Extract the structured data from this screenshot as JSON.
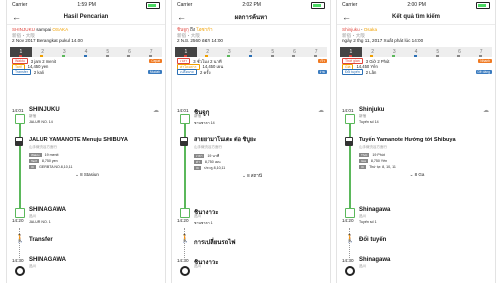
{
  "phones": [
    {
      "status": {
        "carrier": "Carrier",
        "time": "1:59 PM"
      },
      "nav": {
        "back": "←",
        "title": "Hasil Pencarian"
      },
      "route": {
        "from": "SHINJUKU",
        "mid": " sampai ",
        "to": "OSAKA",
        "kana": "新宿・大阪",
        "date": "2 Nov 2017 Berangkat pukul 14.00"
      },
      "tabs": [
        "1",
        "2",
        "3",
        "4",
        "5",
        "6",
        "7"
      ],
      "summary": [
        {
          "tag": "Waktu",
          "text": "3 jam 2 menit",
          "badge": "Cepat",
          "badge_color": "orange"
        },
        {
          "tag": "Tarif",
          "text": "14,450 yen",
          "badge": "",
          "badge_color": ""
        },
        {
          "tag": "Transfer",
          "text": "2 kali",
          "badge": "Mudah",
          "badge_color": "blue"
        }
      ],
      "stop1": {
        "time": "14:01",
        "name": "SHINJUKU",
        "kana": "新宿",
        "platform": "JALUR NO. 14",
        "weather": "☁"
      },
      "train": {
        "name": "JALUR YAMANOTE Menuju SHIBUYA",
        "kana": "山手線渋谷方面行",
        "fares": [
          {
            "label": "Waktu",
            "value": "19 menit"
          },
          {
            "label": "Tarif",
            "value": "8,750 yen"
          },
          {
            "label": "IC",
            "value": "GERBTA NO.8,10,11"
          }
        ],
        "stations": "⌄  8 Stasiun"
      },
      "stop2": {
        "time": "14:20",
        "name": "SHINAGAWA",
        "kana": "品川",
        "platform": "JALUR NO. 1"
      },
      "transfer": {
        "label": "Transfer"
      },
      "stop3": {
        "time": "14:30",
        "name": "SHINAGAWA",
        "kana": "品川"
      }
    },
    {
      "status": {
        "carrier": "Carrier",
        "time": "2:02 PM"
      },
      "nav": {
        "back": "←",
        "title": "ผลการค้นหา"
      },
      "route": {
        "from": "ชินจูกุ",
        "mid": " ถึง ",
        "to": "โอซาก้า",
        "kana": "新宿・大阪",
        "date": "2 พ.ย. 2560 ออก 14:00"
      },
      "tabs": [
        "1",
        "2",
        "3",
        "4",
        "5",
        "6",
        "7"
      ],
      "summary": [
        {
          "tag": "เวลา",
          "text": "3 ชั่วโมง 2 นาที",
          "badge": "เร็ว",
          "badge_color": "orange"
        },
        {
          "tag": "ค่าโดยสาร",
          "text": "14,450 เยน",
          "badge": "",
          "badge_color": ""
        },
        {
          "tag": "เปลี่ยนรถ",
          "text": "2 ครั้ง",
          "badge": "ง่าย",
          "badge_color": "blue"
        }
      ],
      "stop1": {
        "time": "14:01",
        "name": "ชินจูกุ",
        "kana": "新宿",
        "platform": "ชานชาลา 14",
        "weather": "☁"
      },
      "train": {
        "name": "สายยามาโนเตะ ต่อ ชิบูยะ",
        "kana": "山手線渋谷方面行",
        "fares": [
          {
            "label": "เวลา",
            "value": "19 นาที"
          },
          {
            "label": "ค่า",
            "value": "8,750 เยน"
          },
          {
            "label": "IC",
            "value": "ประตู 8,10,11"
          }
        ],
        "stations": "⌄  8 สถานี"
      },
      "stop2": {
        "time": "14:20",
        "name": "ชินางาวะ",
        "kana": "品川",
        "platform": "ชานชาลา 1"
      },
      "transfer": {
        "label": "การเปลี่ยนรถไฟ"
      },
      "stop3": {
        "time": "14:30",
        "name": "ชินางาวะ",
        "kana": "品川"
      }
    },
    {
      "status": {
        "carrier": "Carrier",
        "time": "2:00 PM"
      },
      "nav": {
        "back": "←",
        "title": "Kết quả tìm kiếm"
      },
      "route": {
        "from": "Shinjuku",
        "mid": " - ",
        "to": "Osaka",
        "kana": "新宿・大阪",
        "date": "ngày 2 thg 11, 2017 Xuất phát lúc 14:00"
      },
      "tabs": [
        "1",
        "2",
        "3",
        "4",
        "5",
        "6",
        "7"
      ],
      "summary": [
        {
          "tag": "Thời gian",
          "text": "3 Giờ 2 Phút",
          "badge": "Nhanh",
          "badge_color": "orange"
        },
        {
          "tag": "Giá",
          "text": "14,450 Yên",
          "badge": "",
          "badge_color": ""
        },
        {
          "tag": "Đổi tuyến",
          "text": "2 Lần",
          "badge": "Dễ dàng",
          "badge_color": "blue"
        }
      ],
      "stop1": {
        "time": "14:01",
        "name": "Shinjuku",
        "kana": "新宿",
        "platform": "Tuyến số 14",
        "weather": "☁"
      },
      "train": {
        "name": "Tuyến Yamanote Hướng tới Shibuya",
        "kana": "山手線渋谷方面行",
        "fares": [
          {
            "label": "Thời",
            "value": "19 Phút"
          },
          {
            "label": "Giá",
            "value": "8,750 Yên"
          },
          {
            "label": "IC",
            "value": "Thứ tự: 8, 10, 11"
          }
        ],
        "stations": "⌄  8 Ga"
      },
      "stop2": {
        "time": "14:20",
        "name": "Shinagawa",
        "kana": "品川",
        "platform": "Tuyến số 1"
      },
      "transfer": {
        "label": "Đổi tuyến"
      },
      "stop3": {
        "time": "14:30",
        "name": "Shinagawa",
        "kana": "品川"
      }
    }
  ],
  "colors": {
    "accent_red": "#e0443c",
    "accent_orange": "#f0a000",
    "line_green": "#5bb85b"
  },
  "icons": {
    "walk": "walking-person-icon",
    "weather": "cloud-icon"
  }
}
